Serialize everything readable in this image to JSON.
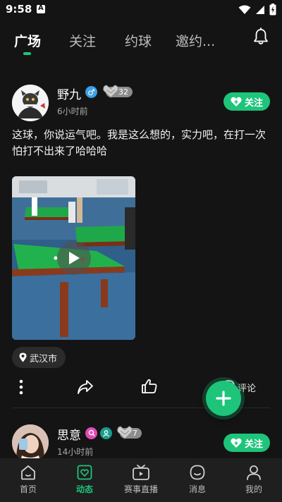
{
  "status_bar": {
    "time": "9:58",
    "battery_icon": "battery-charging-icon",
    "wifi_icon": "wifi-icon",
    "signal_icon": "signal-icon"
  },
  "top_tabs": [
    {
      "label": "广场",
      "active": true
    },
    {
      "label": "关注",
      "active": false
    },
    {
      "label": "约球",
      "active": false
    },
    {
      "label": "邀约...",
      "active": false
    }
  ],
  "posts": [
    {
      "username": "野九",
      "gender": "male",
      "gender_symbol": "♂",
      "level": "32",
      "time": "6小时前",
      "follow_label": "关注",
      "text": "这球，你说运气吧。我是这么想的，实力吧，在打一次怕打不出来了哈哈哈",
      "location": "武汉市",
      "comment_label": "评论"
    },
    {
      "username": "思意",
      "gender": "female",
      "level": "7",
      "time": "14小时前",
      "follow_label": "关注"
    }
  ],
  "bottom_nav": [
    {
      "label": "首页",
      "icon": "home-icon",
      "active": false
    },
    {
      "label": "动态",
      "icon": "feed-icon",
      "active": true
    },
    {
      "label": "赛事直播",
      "icon": "tv-icon",
      "active": false
    },
    {
      "label": "消息",
      "icon": "message-icon",
      "active": false
    },
    {
      "label": "我的",
      "icon": "profile-icon",
      "active": false
    }
  ],
  "colors": {
    "accent": "#1ec47a",
    "background": "#141414",
    "nav_background": "#1f1f1f"
  }
}
